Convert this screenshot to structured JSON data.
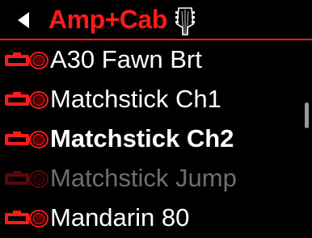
{
  "header": {
    "back_icon": "back-arrow-icon",
    "title": "Amp+Cab",
    "title_icon": "guitar-headstock-icon",
    "accent_color": "#ff1a1a"
  },
  "items": [
    {
      "label": "A30 Fawn Brt",
      "icon": "amp-cab-icon",
      "state": "normal"
    },
    {
      "label": "Matchstick Ch1",
      "icon": "amp-cab-icon",
      "state": "normal"
    },
    {
      "label": "Matchstick Ch2",
      "icon": "amp-cab-icon",
      "state": "selected"
    },
    {
      "label": "Matchstick Jump",
      "icon": "amp-cab-icon",
      "state": "disabled"
    },
    {
      "label": "Mandarin 80",
      "icon": "amp-cab-icon",
      "state": "normal"
    }
  ],
  "scrollbar": {
    "icon": "scroll-thumb"
  }
}
